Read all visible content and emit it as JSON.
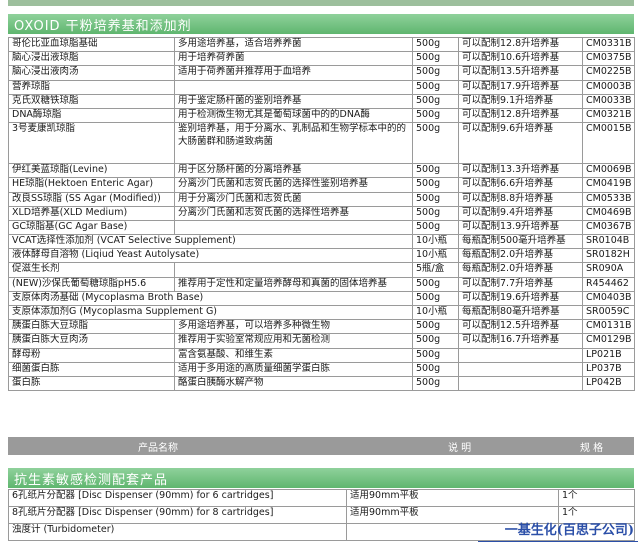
{
  "section1_title": "OXOID 干粉培养基和添加剂",
  "rows": [
    {
      "name": "哥伦比亚血琼脂基础",
      "use": "多用途培养基，适合培养养菌",
      "size": "500g",
      "yield": "可以配制12.8升培养基",
      "code": "CM0331B"
    },
    {
      "name": "脑心浸出液琼脂",
      "use": "用于培养荷养菌",
      "size": "500g",
      "yield": "可以配制10.6升培养基",
      "code": "CM0375B"
    },
    {
      "name": "脑心浸出液肉汤",
      "use": "适用于荷养菌并推荐用于血培养",
      "size": "500g",
      "yield": "可以配制13.5升培养基",
      "code": "CM0225B"
    },
    {
      "name": "营养琼脂",
      "use": "",
      "size": "500g",
      "yield": "可以配制17.9升培养基",
      "code": "CM0003B"
    },
    {
      "name": "克氏双糖铁琼脂",
      "use": "用于鉴定肠杆菌的鉴别培养基",
      "size": "500g",
      "yield": "可以配制9.1升培养基",
      "code": "CM0033B"
    },
    {
      "name": "DNA酶琼脂",
      "use": "用于检测微生物尤其是葡萄球菌中的的DNA酶",
      "size": "500g",
      "yield": "可以配制12.8升培养基",
      "code": "CM0321B"
    },
    {
      "name": "3号麦康凯琼脂",
      "use": "鉴别培养基，用于分离水、乳制品和生物学标本中的的大肠菌群和肠道致病菌",
      "size": "500g",
      "yield": "可以配制9.6升培养基",
      "code": "CM0015B",
      "h": "taller"
    },
    {
      "name": "伊红美蓝琼脂(Levine)",
      "use": "用于区分肠杆菌的分离培养基",
      "size": "500g",
      "yield": "可以配制13.3升培养基",
      "code": "CM0069B"
    },
    {
      "name": "HE琼脂(Hektoen Enteric Agar)",
      "use": "分离沙门氏菌和志贺氏菌的选择性鉴别培养基",
      "size": "500g",
      "yield": "可以配制6.6升培养基",
      "code": "CM0419B"
    },
    {
      "name": "改良SS琼脂 (SS Agar (Modified))",
      "use": "用于分离沙门氏菌和志贺氏菌",
      "size": "500g",
      "yield": "可以配制8.8升培养基",
      "code": "CM0533B"
    },
    {
      "name": "XLD培养基(XLD Medium)",
      "use": "分离沙门氏菌和志贺氏菌的选择性培养基",
      "size": "500g",
      "yield": "可以配制9.4升培养基",
      "code": "CM0469B"
    },
    {
      "name": "GC琼脂基(GC Agar Base)",
      "use": "",
      "size": "500g",
      "yield": "可以配制13.9升培养基",
      "code": "CM0367B"
    },
    {
      "name": "VCAT选择性添加剂 (VCAT Selective Supplement)",
      "use": "",
      "size": "10小瓶",
      "yield": "每瓶配制500毫升培养基",
      "code": "SR0104B",
      "span": true
    },
    {
      "name": "液体酵母自溶物 (Liqiud Yeast Autolysate)",
      "use": "",
      "size": "10小瓶",
      "yield": "每瓶配制2.0升培养基",
      "code": "SR0182H",
      "span": true
    },
    {
      "name": "促滋生长剂",
      "use": "",
      "size": "5瓶/盒",
      "yield": "每瓶配制2.0升培养基",
      "code": "SR090A"
    },
    {
      "name": "(NEW)沙保氏葡萄糖琼脂pH5.6",
      "use": "推荐用于定性和定量培养酵母和真菌的固体培养基",
      "size": "500g",
      "yield": "可以配制7.7升培养基",
      "code": "R454462"
    },
    {
      "name": "支原体肉汤基础 (Mycoplasma Broth Base)",
      "use": "",
      "size": "500g",
      "yield": "可以配制19.6升培养基",
      "code": "CM0403B",
      "span": true
    },
    {
      "name": "支原体添加剂G (Mycoplasma Supplement G)",
      "use": "",
      "size": "10小瓶",
      "yield": "每瓶配制80毫升培养基",
      "code": "SR0059C",
      "span": true
    },
    {
      "name": "胰蛋白胨大豆琼脂",
      "use": "多用途培养基，可以培养多种微生物",
      "size": "500g",
      "yield": "可以配制12.5升培养基",
      "code": "CM0131B"
    },
    {
      "name": "胰蛋白胨大豆肉汤",
      "use": "推荐用于实验室常规应用和无菌检测",
      "size": "500g",
      "yield": "可以配制16.7升培养基",
      "code": "CM0129B"
    },
    {
      "name": "酵母粉",
      "use": "富含氨基酸、和维生素",
      "size": "500g",
      "yield": "",
      "code": "LP021B"
    },
    {
      "name": "细菌蛋白胨",
      "use": "适用于多用途的高质量细菌学蛋白胨",
      "size": "500g",
      "yield": "",
      "code": "LP037B"
    },
    {
      "name": "蛋白胨",
      "use": "酪蛋白胰酶水解产物",
      "size": "500g",
      "yield": "",
      "code": "LP042B"
    }
  ],
  "header": {
    "name": "产品名称",
    "desc": "说 明",
    "spec": "规 格"
  },
  "section2_title": "抗生素敏感检测配套产品",
  "rows2": [
    {
      "name": "6孔纸片分配器 [Disc Dispenser (90mm) for 6 cartridges]",
      "desc": "适用90mm平板",
      "spec": "1个"
    },
    {
      "name": "8孔纸片分配器 [Disc Dispenser (90mm) for 8 cartridges]",
      "desc": "适用90mm平板",
      "spec": "1个"
    },
    {
      "name": "浊度计 (Turbidometer)",
      "desc": "",
      "spec": ""
    }
  ],
  "brand": "一基生化(百思子公司)"
}
